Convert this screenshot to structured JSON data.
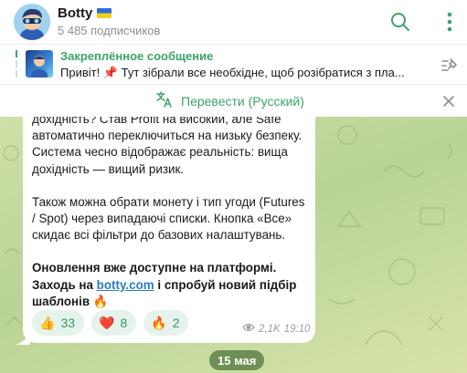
{
  "header": {
    "channel_name": "Botty",
    "subscribers": "5 485 подписчиков"
  },
  "pinned": {
    "title": "Закреплённое сообщение",
    "text": "Привіт!  📌 Тут зібрали все необхідне, щоб розібратися з пла..."
  },
  "translate": {
    "label": "Перевести (Русский)"
  },
  "message": {
    "paragraph1": "дохідність? Став Profit на високий, але Safe автоматично переключиться на низьку безпеку. Система чесно відображає реальність: вища дохідність — вищий ризик.",
    "paragraph2": "Також можна обрати монету і тип угоди (Futures / Spot) через випадаючі списки. Кнопка «Все» скидає всі фільтри до базових налаштувань.",
    "paragraph3_line1": "Оновлення вже доступне на платформі.",
    "paragraph3_prefix": "Заходь на ",
    "paragraph3_link": "botty.com",
    "paragraph3_suffix": " і спробуй новий підбір шаблонів 🔥"
  },
  "reactions": [
    {
      "emoji": "👍",
      "count": "33"
    },
    {
      "emoji": "❤️",
      "count": "8"
    },
    {
      "emoji": "🔥",
      "count": "2"
    }
  ],
  "meta": {
    "views": "2,1K",
    "time": "19:10"
  },
  "date_separator": "15 мая",
  "colors": {
    "accent_green": "#3ba36a",
    "link_blue": "#2a7cc7",
    "chat_background": "#c5d99c",
    "date_pill": "#6e8f55"
  },
  "icons": {
    "search": "search-icon",
    "more": "more-vertical-icon",
    "pinned_list": "pin-list-icon",
    "translate": "translate-icon",
    "close": "close-icon",
    "views": "eye-icon"
  }
}
